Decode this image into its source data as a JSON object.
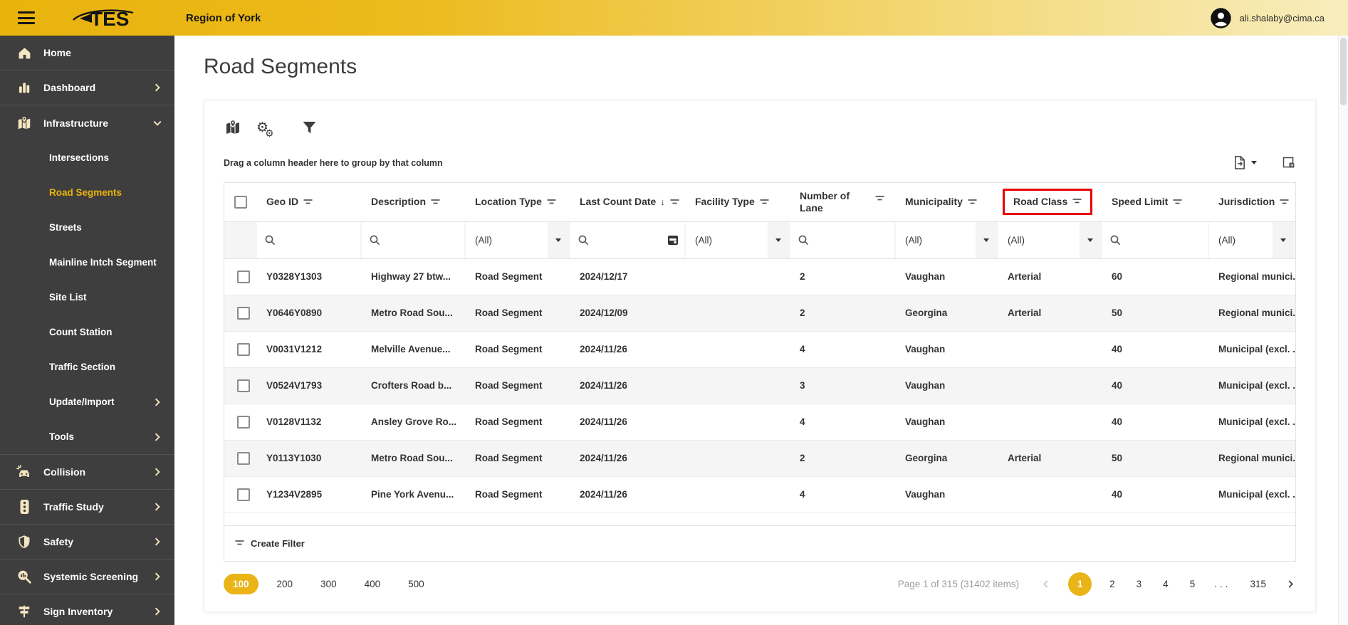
{
  "topbar": {
    "logo_text": "TES",
    "region_title": "Region of York",
    "user_email": "ali.shalaby@cima.ca"
  },
  "page": {
    "title": "Road Segments"
  },
  "sidebar": {
    "items": [
      {
        "label": "Home"
      },
      {
        "label": "Dashboard"
      },
      {
        "label": "Infrastructure"
      },
      {
        "label": "Collision"
      },
      {
        "label": "Traffic Study"
      },
      {
        "label": "Safety"
      },
      {
        "label": "Systemic Screening"
      },
      {
        "label": "Sign Inventory"
      }
    ],
    "infrastructure_children": [
      {
        "label": "Intersections"
      },
      {
        "label": "Road Segments"
      },
      {
        "label": "Streets"
      },
      {
        "label": "Mainline Intch Segment"
      },
      {
        "label": "Site List"
      },
      {
        "label": "Count Station"
      },
      {
        "label": "Traffic Section"
      },
      {
        "label": "Update/Import"
      },
      {
        "label": "Tools"
      }
    ],
    "active_item": "Road Segments"
  },
  "grid_toolbar": {
    "drag_hint": "Drag a column header here to group by that column"
  },
  "grid": {
    "columns": [
      {
        "label": "Geo ID"
      },
      {
        "label": "Description"
      },
      {
        "label": "Location Type"
      },
      {
        "label": "Last Count Date",
        "sort": "desc"
      },
      {
        "label": "Facility Type"
      },
      {
        "label": "Number of Lane"
      },
      {
        "label": "Municipality"
      },
      {
        "label": "Road Class",
        "annotated": true
      },
      {
        "label": "Speed Limit"
      },
      {
        "label": "Jurisdiction"
      }
    ],
    "filters": {
      "location_type": "(All)",
      "facility_type": "(All)",
      "municipality": "(All)",
      "road_class": "(All)",
      "jurisdiction": "(All)"
    },
    "rows": [
      {
        "geo_id": "Y0328Y1303",
        "description": "Highway 27 btw...",
        "location_type": "Road Segment",
        "last_count_date": "2024/12/17",
        "facility_type": "",
        "number_of_lane": "2",
        "municipality": "Vaughan",
        "road_class": "Arterial",
        "speed_limit": "60",
        "jurisdiction": "Regional munici..."
      },
      {
        "geo_id": "Y0646Y0890",
        "description": "Metro Road Sou...",
        "location_type": "Road Segment",
        "last_count_date": "2024/12/09",
        "facility_type": "",
        "number_of_lane": "2",
        "municipality": "Georgina",
        "road_class": "Arterial",
        "speed_limit": "50",
        "jurisdiction": "Regional munici..."
      },
      {
        "geo_id": "V0031V1212",
        "description": "Melville Avenue...",
        "location_type": "Road Segment",
        "last_count_date": "2024/11/26",
        "facility_type": "",
        "number_of_lane": "4",
        "municipality": "Vaughan",
        "road_class": "",
        "speed_limit": "40",
        "jurisdiction": "Municipal (excl. ..."
      },
      {
        "geo_id": "V0524V1793",
        "description": "Crofters Road b...",
        "location_type": "Road Segment",
        "last_count_date": "2024/11/26",
        "facility_type": "",
        "number_of_lane": "3",
        "municipality": "Vaughan",
        "road_class": "",
        "speed_limit": "40",
        "jurisdiction": "Municipal (excl. ..."
      },
      {
        "geo_id": "V0128V1132",
        "description": "Ansley Grove Ro...",
        "location_type": "Road Segment",
        "last_count_date": "2024/11/26",
        "facility_type": "",
        "number_of_lane": "4",
        "municipality": "Vaughan",
        "road_class": "",
        "speed_limit": "40",
        "jurisdiction": "Municipal (excl. ..."
      },
      {
        "geo_id": "Y0113Y1030",
        "description": "Metro Road Sou...",
        "location_type": "Road Segment",
        "last_count_date": "2024/11/26",
        "facility_type": "",
        "number_of_lane": "2",
        "municipality": "Georgina",
        "road_class": "Arterial",
        "speed_limit": "50",
        "jurisdiction": "Regional munici..."
      },
      {
        "geo_id": "Y1234V2895",
        "description": "Pine York Avenu...",
        "location_type": "Road Segment",
        "last_count_date": "2024/11/26",
        "facility_type": "",
        "number_of_lane": "4",
        "municipality": "Vaughan",
        "road_class": "",
        "speed_limit": "40",
        "jurisdiction": "Municipal (excl. ..."
      }
    ],
    "create_filter_label": "Create Filter"
  },
  "pager": {
    "page_sizes": [
      "100",
      "200",
      "300",
      "400",
      "500"
    ],
    "selected_size": "100",
    "summary": "Page 1 of 315 (31402 items)",
    "pages": [
      "1",
      "2",
      "3",
      "4",
      "5",
      "...",
      "315"
    ],
    "current_page": "1"
  },
  "colors": {
    "accent_gold": "#eab417",
    "annotation_red": "#e60000",
    "sidebar_bg": "#3e3e3e",
    "topbar_gradient_left": "#e9b30d",
    "topbar_gradient_right": "#f8edbd"
  }
}
